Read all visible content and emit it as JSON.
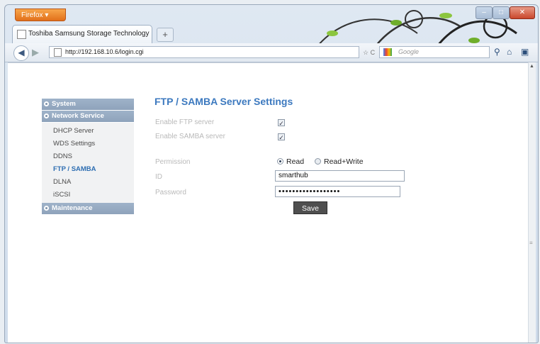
{
  "browser": {
    "menu_button": "Firefox",
    "tab_title": "Toshiba Samsung Storage Technology",
    "new_tab": "+",
    "url": "http://192.168.10.6/login.cgi",
    "search_placeholder": "Google"
  },
  "sidebar": {
    "sections": [
      {
        "label": "System"
      },
      {
        "label": "Network Service"
      },
      {
        "label": "Maintenance"
      }
    ],
    "items": [
      {
        "label": "DHCP Server"
      },
      {
        "label": "WDS Settings"
      },
      {
        "label": "DDNS"
      },
      {
        "label": "FTP / SAMBA"
      },
      {
        "label": "DLNA"
      },
      {
        "label": "iSCSI"
      }
    ]
  },
  "form": {
    "title": "FTP / SAMBA Server Settings",
    "enable_ftp_label": "Enable FTP server",
    "enable_ftp_checked": true,
    "enable_samba_label": "Enable SAMBA server",
    "enable_samba_checked": true,
    "permission_label": "Permission",
    "permission_options": [
      "Read",
      "Read+Write"
    ],
    "permission_selected": "Read",
    "id_label": "ID",
    "id_value": "smarthub",
    "password_label": "Password",
    "password_value": "••••••••••••••••••",
    "save_label": "Save"
  },
  "colors": {
    "title": "#3c79bf",
    "sidebar_header": "#8ea3bb",
    "active_item": "#2e6eb2",
    "save_button": "#4f4f4f"
  }
}
